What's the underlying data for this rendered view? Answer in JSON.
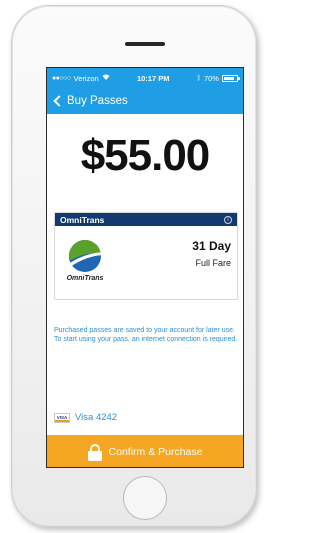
{
  "status_bar": {
    "signal": "●●○○○",
    "carrier": "Verizon",
    "time": "10:17 PM",
    "battery_text": "70%"
  },
  "nav": {
    "back_label": "Buy Passes"
  },
  "price": "$55.00",
  "pass_card": {
    "agency": "OmniTrans",
    "logo_text": "OmniTrans",
    "duration": "31 Day",
    "fare_type": "Full Fare"
  },
  "info_text": "Purchased passes are saved to your account for later use. To start using your pass, an internet connection is required.",
  "payment": {
    "card_icon_text": "VISA",
    "card_label": "Visa 4242"
  },
  "confirm_button": {
    "label": "Confirm & Purchase"
  },
  "colors": {
    "nav_blue": "#1f9ee6",
    "card_header_navy": "#133a70",
    "link_blue": "#2b8fd6",
    "button_orange": "#f5a623",
    "logo_green": "#5aa02c",
    "logo_blue": "#1f67b1"
  }
}
